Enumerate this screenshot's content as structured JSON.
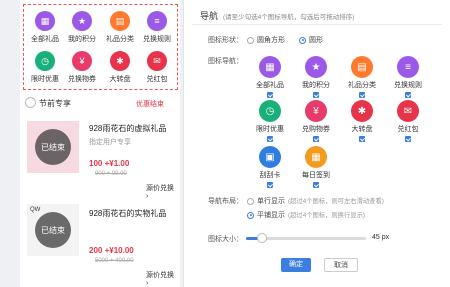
{
  "preview": {
    "nav_items": [
      {
        "label": "全部礼品",
        "color": "#9b59e8",
        "icon": "gift-icon"
      },
      {
        "label": "我的积分",
        "color": "#9b59e8",
        "icon": "star-icon"
      },
      {
        "label": "礼品分类",
        "color": "#ff7a2e",
        "icon": "category-icon"
      },
      {
        "label": "兑换规则",
        "color": "#9b59e8",
        "icon": "rules-icon"
      },
      {
        "label": "限时优惠",
        "color": "#19b07a",
        "icon": "clock-icon"
      },
      {
        "label": "兑换物券",
        "color": "#e83a6b",
        "icon": "coupon-icon"
      },
      {
        "label": "大转盘",
        "color": "#e8344a",
        "icon": "wheel-icon"
      },
      {
        "label": "兑红包",
        "color": "#e8344a",
        "icon": "redpacket-icon"
      }
    ],
    "section_title": "节前专享",
    "section_status": "优惠结束",
    "products": [
      {
        "name": "928雨花石的虚拟礼品",
        "sub": "指定用户专享",
        "price": "100 +¥1.00",
        "old": "900 + 99.00",
        "ended": "已结束",
        "exchange": "源价兑换 ›"
      },
      {
        "name": "928雨花石的实物礼品",
        "sub": "",
        "price": "200 +¥10.00",
        "old": "5000 + 400.00",
        "ended": "已结束",
        "exchange": "源价兑换 ›"
      }
    ],
    "brand": "QW"
  },
  "panel": {
    "title": "导航",
    "tip": "(请至少勾选4个图标导航，勾选后可拖动排序)",
    "shape_label": "图标形状：",
    "shape_options": [
      {
        "label": "圆角方形",
        "selected": false
      },
      {
        "label": "圆形",
        "selected": true
      }
    ],
    "nav_label": "图标导航：",
    "icons": [
      {
        "label": "全部礼品",
        "color": "#9b59e8",
        "icon": "gift-icon"
      },
      {
        "label": "我的积分",
        "color": "#9b59e8",
        "icon": "star-icon"
      },
      {
        "label": "礼品分类",
        "color": "#ff7a2e",
        "icon": "category-icon"
      },
      {
        "label": "兑换规则",
        "color": "#9b59e8",
        "icon": "rules-icon"
      },
      {
        "label": "限时优惠",
        "color": "#19b07a",
        "icon": "clock-icon"
      },
      {
        "label": "兑购物券",
        "color": "#e83a6b",
        "icon": "coupon-icon"
      },
      {
        "label": "大转盘",
        "color": "#e8344a",
        "icon": "wheel-icon"
      },
      {
        "label": "兑红包",
        "color": "#e8344a",
        "icon": "redpacket-icon"
      },
      {
        "label": "刮刮卡",
        "color": "#2f7de0",
        "icon": "scratch-icon"
      },
      {
        "label": "每日签到",
        "color": "#f29b1d",
        "icon": "calendar-icon"
      }
    ],
    "layout_label": "导航布局：",
    "layout_options": [
      {
        "label": "单行显示",
        "hint": "(超过4个图标，则可左右滑动查看)",
        "selected": false
      },
      {
        "label": "平铺显示",
        "hint": "(超过4个图标，则换行显示)",
        "selected": true
      }
    ],
    "size_label": "图标大小：",
    "size_value": "45",
    "size_unit": "px",
    "size_fraction": 0.13,
    "ok_label": "确定",
    "cancel_label": "取消"
  }
}
